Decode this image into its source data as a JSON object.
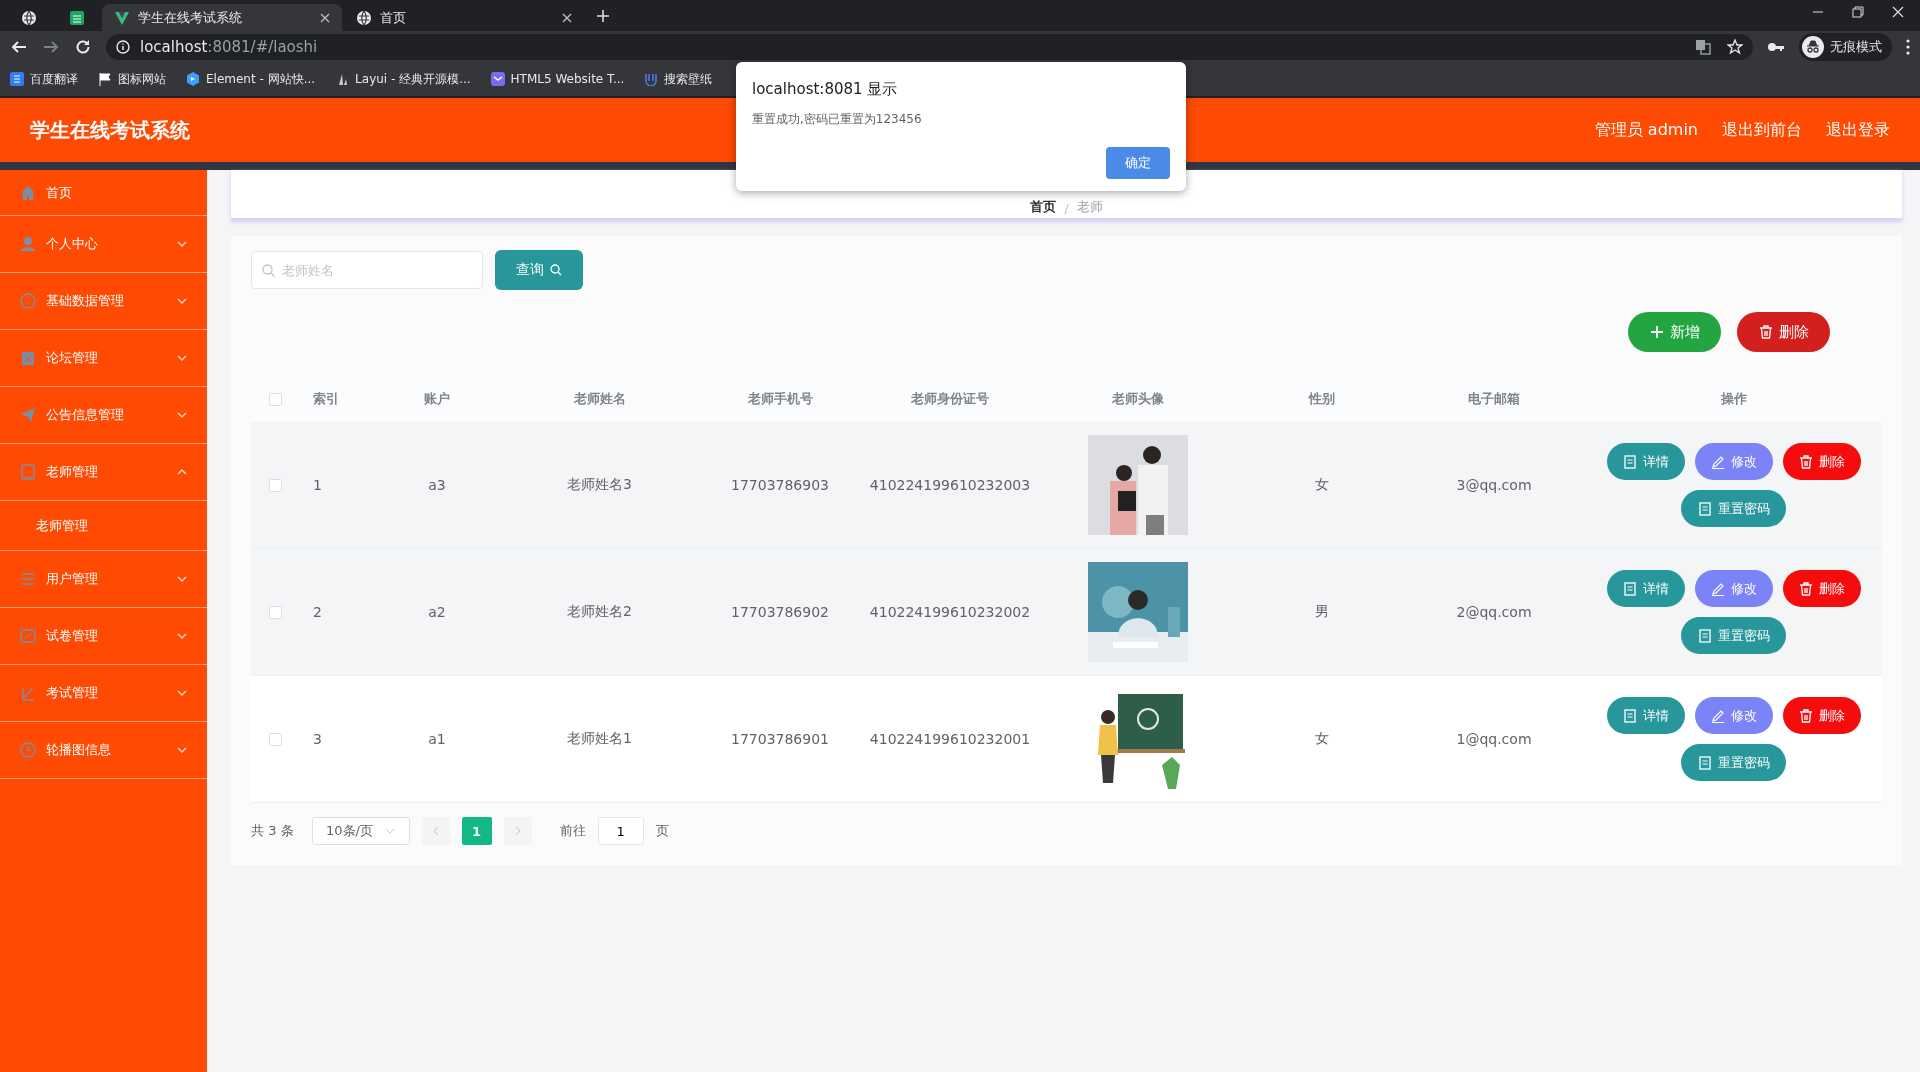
{
  "browser": {
    "tabs": [
      {
        "selected": false
      },
      {
        "selected": false
      },
      {
        "title": "学生在线考试系统",
        "selected": true
      },
      {
        "title": "首页",
        "selected": false
      }
    ],
    "address": {
      "host": "localhost",
      "rest": ":8081/#/laoshi"
    },
    "bookmarks": [
      "百度翻译",
      "图标网站",
      "Element - 网站快...",
      "Layui - 经典开源模...",
      "HTML5 Website T...",
      "搜索壁纸"
    ],
    "incognito_label": "无痕模式"
  },
  "header": {
    "title": "学生在线考试系统",
    "links": [
      "管理员 admin",
      "退出到前台",
      "退出登录"
    ]
  },
  "sidebar": {
    "items": [
      {
        "label": "首页"
      },
      {
        "label": "个人中心",
        "expanded": false
      },
      {
        "label": "基础数据管理",
        "expanded": false
      },
      {
        "label": "论坛管理",
        "expanded": false
      },
      {
        "label": "公告信息管理",
        "expanded": false
      },
      {
        "label": "老师管理",
        "expanded": true,
        "children": [
          {
            "label": "老师管理"
          }
        ]
      },
      {
        "label": "用户管理",
        "expanded": false
      },
      {
        "label": "试卷管理",
        "expanded": false
      },
      {
        "label": "考试管理",
        "expanded": false
      },
      {
        "label": "轮播图信息",
        "expanded": false
      }
    ]
  },
  "breadcrumb": {
    "separator": "/",
    "items": [
      "首页",
      "老师"
    ]
  },
  "search": {
    "placeholder": "老师姓名",
    "button": "查询"
  },
  "toolbar": [
    {
      "label": "新增",
      "kind": "add"
    },
    {
      "label": "删除",
      "kind": "delete"
    }
  ],
  "table": {
    "all_selected": false,
    "columns": [
      "索引",
      "账户",
      "老师姓名",
      "老师手机号",
      "老师身份证号",
      "老师头像",
      "性别",
      "电子邮箱",
      "操作"
    ],
    "rows": [
      {
        "selected": false,
        "cells": [
          "1",
          "a3",
          "老师姓名3",
          "17703786903",
          "410224199610232003",
          {
            "kind": "picture"
          },
          "女",
          "3@qq.com"
        ],
        "actions": [
          {
            "label": "详情",
            "kind": "detail"
          },
          {
            "label": "修改",
            "kind": "edit"
          },
          {
            "label": "删除",
            "kind": "delete"
          },
          {
            "label": "重置密码",
            "kind": "reset"
          }
        ]
      },
      {
        "selected": false,
        "cells": [
          "2",
          "a2",
          "老师姓名2",
          "17703786902",
          "410224199610232002",
          {
            "kind": "picture"
          },
          "男",
          "2@qq.com"
        ],
        "actions": [
          {
            "label": "详情",
            "kind": "detail"
          },
          {
            "label": "修改",
            "kind": "edit"
          },
          {
            "label": "删除",
            "kind": "delete"
          },
          {
            "label": "重置密码",
            "kind": "reset"
          }
        ]
      },
      {
        "selected": false,
        "cells": [
          "3",
          "a1",
          "老师姓名1",
          "17703786901",
          "410224199610232001",
          {
            "kind": "picture"
          },
          "女",
          "1@qq.com"
        ],
        "actions": [
          {
            "label": "详情",
            "kind": "detail"
          },
          {
            "label": "修改",
            "kind": "edit"
          },
          {
            "label": "删除",
            "kind": "delete"
          },
          {
            "label": "重置密码",
            "kind": "reset"
          }
        ]
      }
    ]
  },
  "pagination": {
    "total": "共 3 条",
    "page_size": "10条/页",
    "pages": [
      {
        "label": "1",
        "selected": true
      }
    ],
    "goto_label": "前往",
    "goto_value": "1",
    "suffix": "页"
  },
  "dialog": {
    "title": "localhost:8081 显示",
    "message": "重置成功,密码已重置为123456",
    "button": "确定"
  }
}
